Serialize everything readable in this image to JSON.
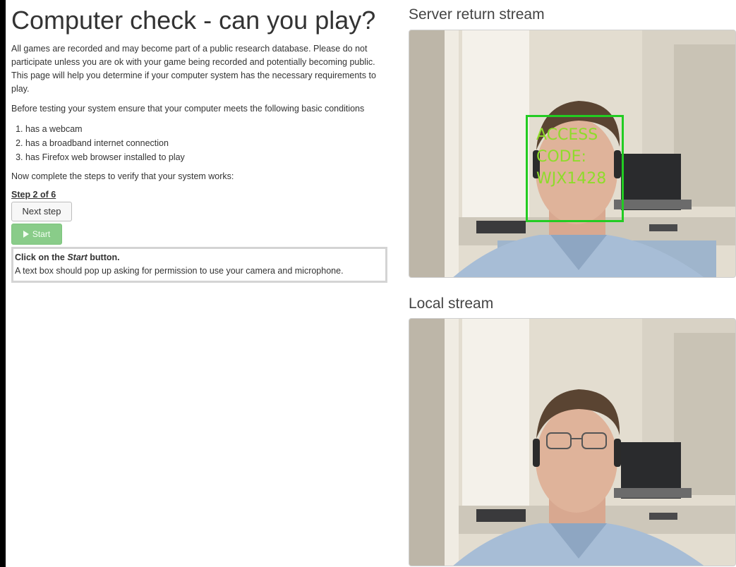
{
  "page": {
    "title": "Computer check - can you play?",
    "intro": "All games are recorded and may become part of a public research database. Please do not participate unless you are ok with your game being recorded and potentially becoming public. This page will help you determine if your computer system has the necessary requirements to play.",
    "conditions_intro": "Before testing your system ensure that your computer meets the following basic conditions",
    "requirements": [
      "has a webcam",
      "has a broadband internet connection",
      "has Firefox web browser installed to play"
    ],
    "steps_intro": "Now complete the steps to verify that your system works:"
  },
  "steps": {
    "label": "Step 2 of 6",
    "current": 2,
    "total": 6,
    "next_label": "Next step",
    "start_label": "Start",
    "instruction_prefix": "Click on the ",
    "instruction_emph": "Start",
    "instruction_suffix": " button.",
    "instruction_text": "A text box should pop up asking for permission to use your camera and microphone."
  },
  "streams": {
    "server_title": "Server return stream",
    "local_title": "Local stream",
    "overlay_line1": "ACCESS",
    "overlay_line2": "CODE:",
    "overlay_line3": "WJX1428"
  },
  "colors": {
    "overlay_box": "#22cc22",
    "overlay_text": "#8edc2a",
    "start_button": "#89cc89"
  }
}
